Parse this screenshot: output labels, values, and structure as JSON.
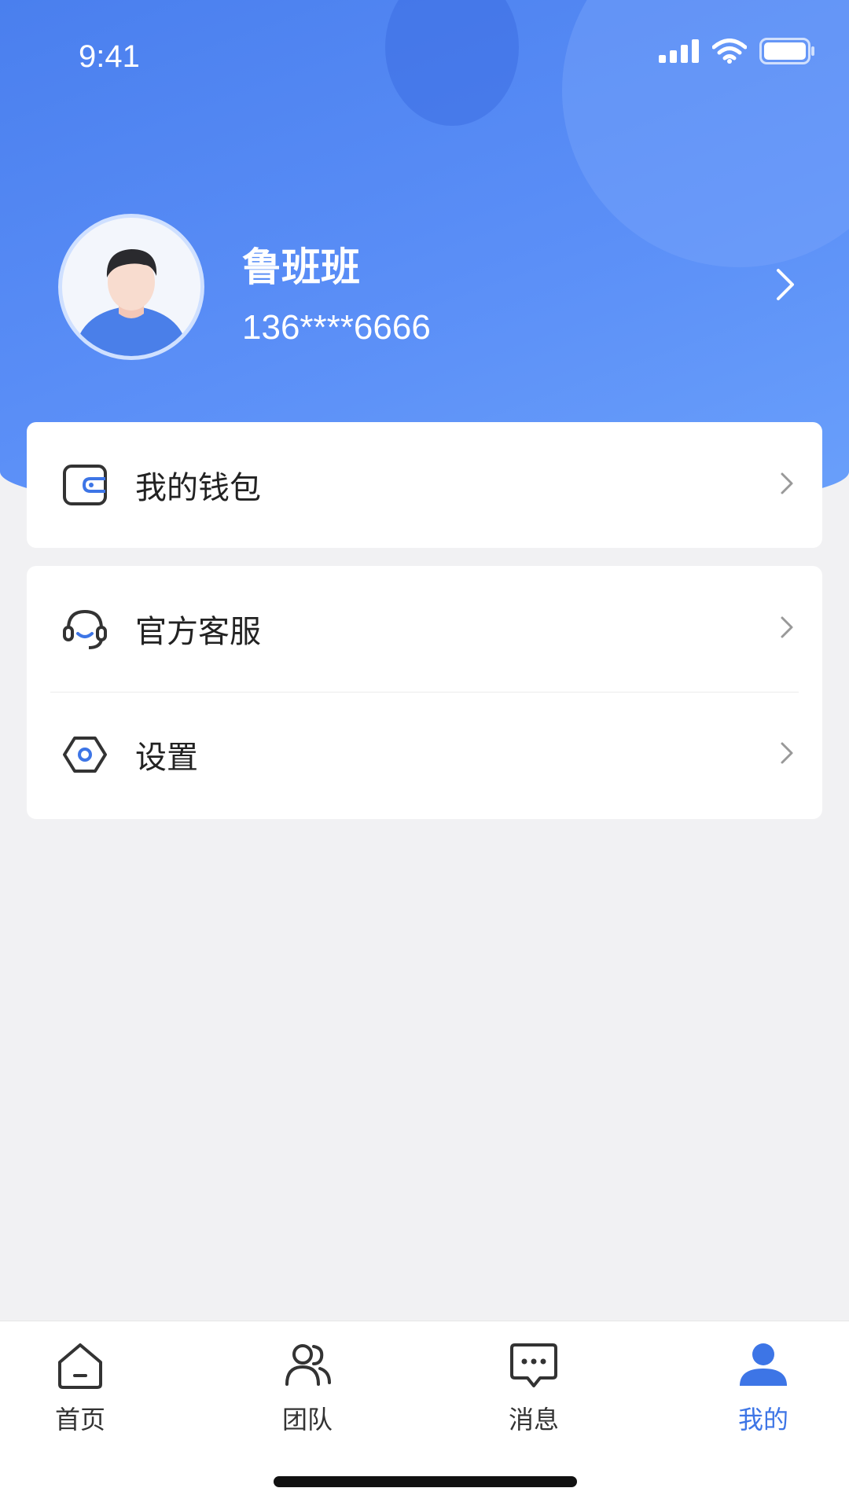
{
  "status_bar": {
    "time": "9:41"
  },
  "profile": {
    "name": "鲁班班",
    "phone": "136****6666"
  },
  "menu": {
    "wallet_label": "我的钱包",
    "service_label": "官方客服",
    "settings_label": "设置"
  },
  "tabbar": {
    "items": [
      {
        "label": "首页",
        "icon": "home-icon",
        "active": false
      },
      {
        "label": "团队",
        "icon": "team-icon",
        "active": false
      },
      {
        "label": "消息",
        "icon": "message-icon",
        "active": false
      },
      {
        "label": "我的",
        "icon": "profile-icon",
        "active": true
      }
    ]
  },
  "colors": {
    "accent": "#3d75e6",
    "header_gradient_start": "#4a7fee",
    "header_gradient_end": "#6aa0fb",
    "background": "#f1f1f3"
  }
}
